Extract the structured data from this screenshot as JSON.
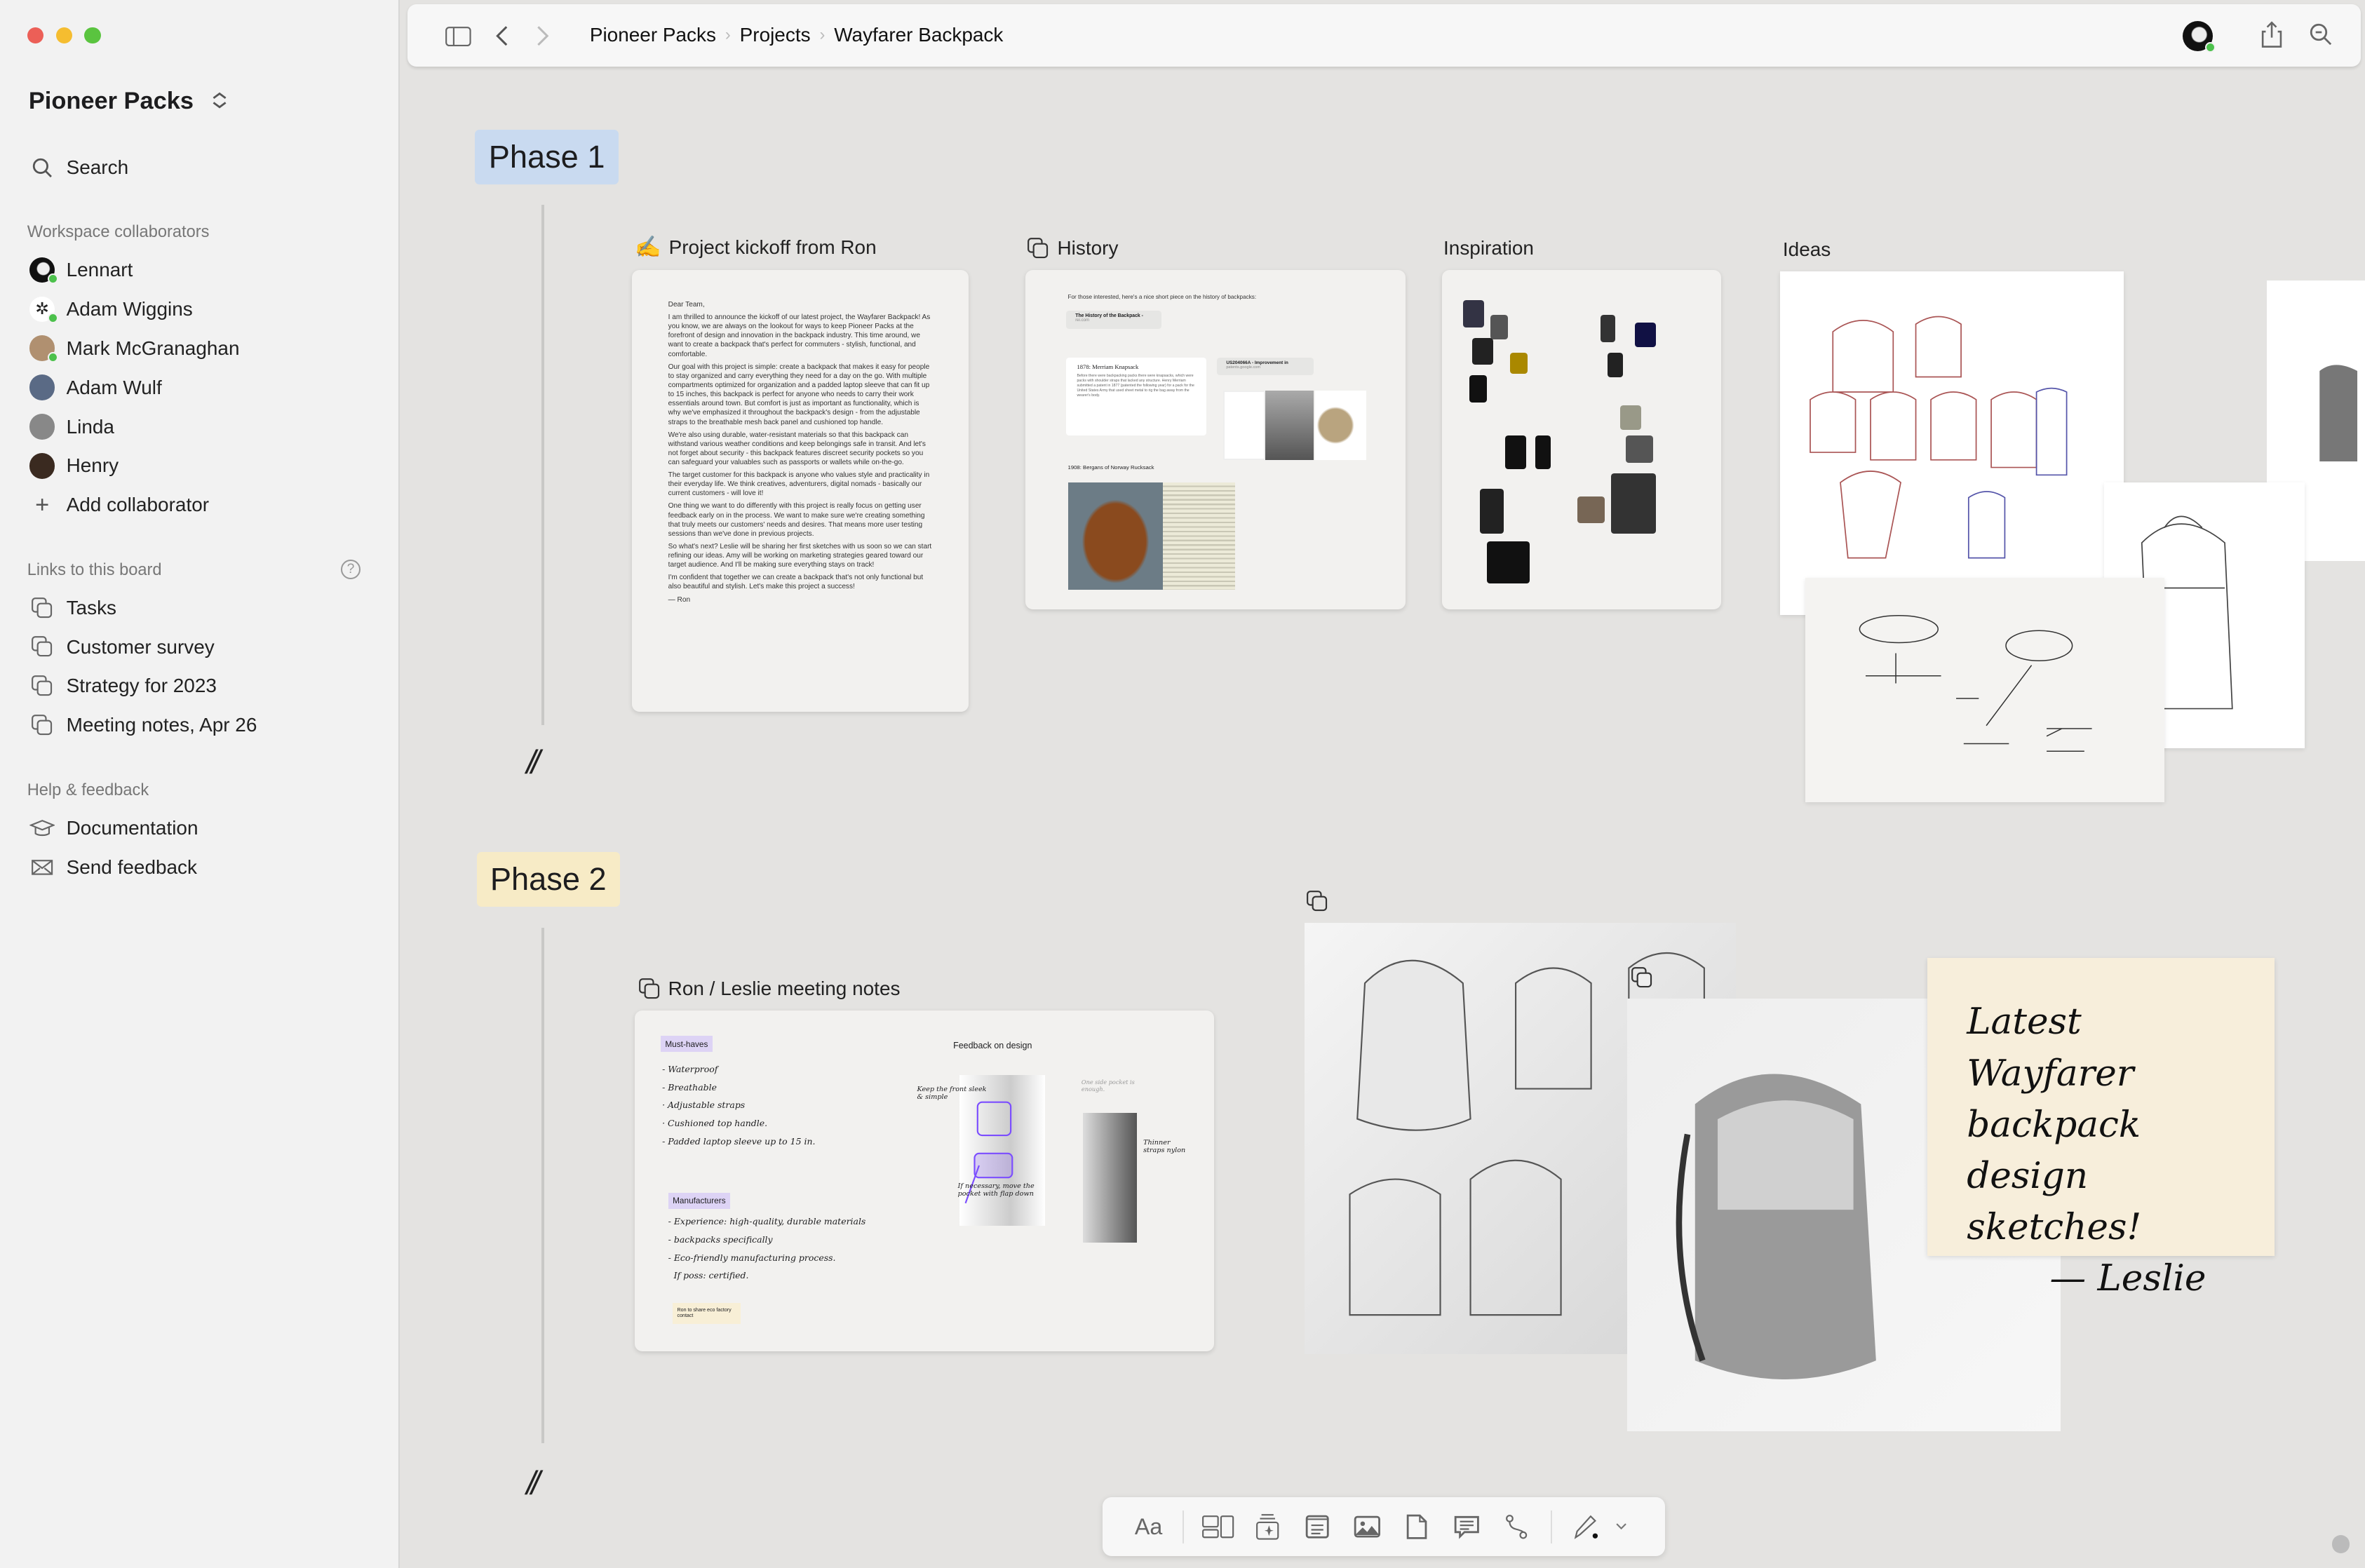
{
  "sidebar": {
    "workspace": "Pioneer Packs",
    "search": "Search",
    "collaborators_heading": "Workspace collaborators",
    "collaborators": [
      {
        "name": "Lennart",
        "online": true
      },
      {
        "name": "Adam Wiggins",
        "online": true
      },
      {
        "name": "Mark McGranaghan",
        "online": true
      },
      {
        "name": "Adam Wulf",
        "online": false
      },
      {
        "name": "Linda",
        "online": false
      },
      {
        "name": "Henry",
        "online": false
      }
    ],
    "add_collaborator": "Add collaborator",
    "links_heading": "Links to this board",
    "links": [
      "Tasks",
      "Customer survey",
      "Strategy for 2023",
      "Meeting notes, Apr 26"
    ],
    "help_heading": "Help & feedback",
    "help": [
      "Documentation",
      "Send feedback"
    ]
  },
  "topbar": {
    "breadcrumb": [
      "Pioneer Packs",
      "Projects",
      "Wayfarer Backpack"
    ]
  },
  "board": {
    "phase1": "Phase 1",
    "phase2": "Phase 2",
    "break": "//",
    "kickoff": {
      "title": "Project kickoff from Ron",
      "paragraphs": [
        "Dear Team,",
        "I am thrilled to announce the kickoff of our latest project, the Wayfarer Backpack! As you know, we are always on the lookout for ways to keep Pioneer Packs at the forefront of design and innovation in the backpack industry. This time around, we want to create a backpack that's perfect for commuters - stylish, functional, and comfortable.",
        "Our goal with this project is simple: create a backpack that makes it easy for people to stay organized and carry everything they need for a day on the go. With multiple compartments optimized for organization and a padded laptop sleeve that can fit up to 15 inches, this backpack is perfect for anyone who needs to carry their work essentials around town. But comfort is just as important as functionality, which is why we've emphasized it throughout the backpack's design - from the adjustable straps to the breathable mesh back panel and cushioned top handle.",
        "We're also using durable, water-resistant materials so that this backpack can withstand various weather conditions and keep belongings safe in transit. And let's not forget about security - this backpack features discreet security pockets so you can safeguard your valuables such as passports or wallets while on-the-go.",
        "The target customer for this backpack is anyone who values style and practicality in their everyday life. We think creatives, adventurers, digital nomads - basically our current customers - will love it!",
        "One thing we want to do differently with this project is really focus on getting user feedback early on in the process. We want to make sure we're creating something that truly meets our customers' needs and desires. That means more user testing sessions than we've done in previous projects.",
        "So what's next? Leslie will be sharing her first sketches with us soon so we can start refining our ideas. Amy will be working on marketing strategies geared toward our target audience. And I'll be making sure everything stays on track!",
        "I'm confident that together we can create a backpack that's not only functional but also beautiful and stylish. Let's make this project a success!",
        "— Ron"
      ]
    },
    "history": {
      "title": "History",
      "intro": "For those interested, here's a nice short piece on the history of backpacks:",
      "link1": {
        "title": "The History of the Backpack -",
        "domain": "rei.com"
      },
      "section1": "1878: Merriam Knapsack",
      "section1_text": "Before there were backpacking packs there were knapsacks, which were packs with shoulder straps that lacked any structure. Henry Merriam submitted a patent in 1877 (patented the following year) for a pack for the United States Army that used sheet metal to rig the bag away from the wearer's body.",
      "link2": {
        "title": "US204066A - Improvement in",
        "domain": "patents.google.com"
      },
      "section2": "1908: Bergans of Norway Rucksack"
    },
    "inspiration": {
      "title": "Inspiration"
    },
    "ideas": {
      "title": "Ideas"
    },
    "meeting": {
      "title": "Ron / Leslie meeting notes",
      "must_haves": "Must-haves",
      "must_items": [
        "- Waterproof",
        "- Breathable",
        "· Adjustable straps",
        "· Cushioned top handle.",
        "- Padded laptop sleeve up to 15 in."
      ],
      "manufacturers": "Manufacturers",
      "man_items": [
        "- Experience: high-quality, durable materials",
        "- backpacks specifically",
        "- Eco-friendly manufacturing process.",
        "  If poss: certified."
      ],
      "note": "Ron to share eco factory contact",
      "feedback": "Feedback on design",
      "ann1": "Keep the front sleek & simple",
      "ann2": "If necessary, move the pocket with flap down",
      "ann3": "Thinner straps nylon",
      "ann4": "One side pocket is enough."
    },
    "sticky": [
      "Latest Wayfarer",
      "backpack",
      "design sketches!",
      "— Leslie"
    ]
  },
  "toolbar": {
    "text_label": "Aa",
    "tools": [
      "layout",
      "ai-card",
      "note",
      "image",
      "file",
      "comment",
      "connector",
      "pen"
    ]
  },
  "colors": {
    "phase1": "#c9daf0",
    "phase2": "#f7ebc6",
    "sticky": "#f7eedb",
    "purple": "#7b4dff",
    "online": "#4cc14c"
  }
}
